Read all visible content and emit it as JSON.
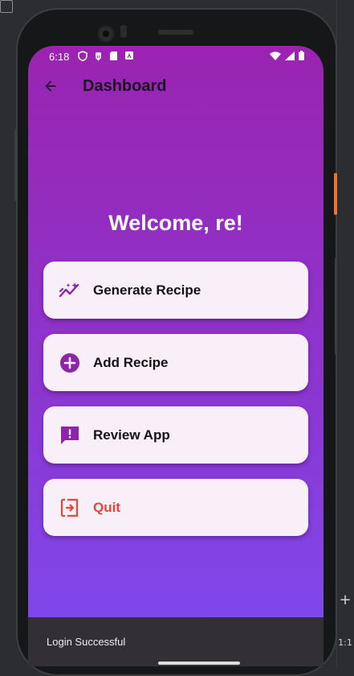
{
  "status_bar": {
    "time": "6:18",
    "icons_left": [
      "shield-icon",
      "bug-icon",
      "sd-card-icon",
      "accessibility-icon"
    ],
    "icons_right": [
      "wifi-icon",
      "signal-icon",
      "battery-icon"
    ]
  },
  "app_bar": {
    "title": "Dashboard",
    "back_icon": "arrow-back-icon"
  },
  "welcome_text": "Welcome, re!",
  "menu": [
    {
      "label": "Generate Recipe",
      "icon": "auto-graph-icon",
      "color": "#8e24aa"
    },
    {
      "label": "Add Recipe",
      "icon": "add-circle-icon",
      "color": "#8e24aa"
    },
    {
      "label": "Review App",
      "icon": "feedback-icon",
      "color": "#8e24aa"
    },
    {
      "label": "Quit",
      "icon": "exit-icon",
      "color": "#e04a3c"
    }
  ],
  "snackbar": {
    "message": "Login Successful"
  },
  "emulator_toolbar": {
    "zoom_in": "+",
    "ratio": "1:1"
  },
  "colors": {
    "gradient_top": "#9a24b0",
    "gradient_bottom": "#7c4bf0",
    "card_background": "#f8eff8",
    "accent": "#8e24aa",
    "danger": "#e04a3c"
  }
}
